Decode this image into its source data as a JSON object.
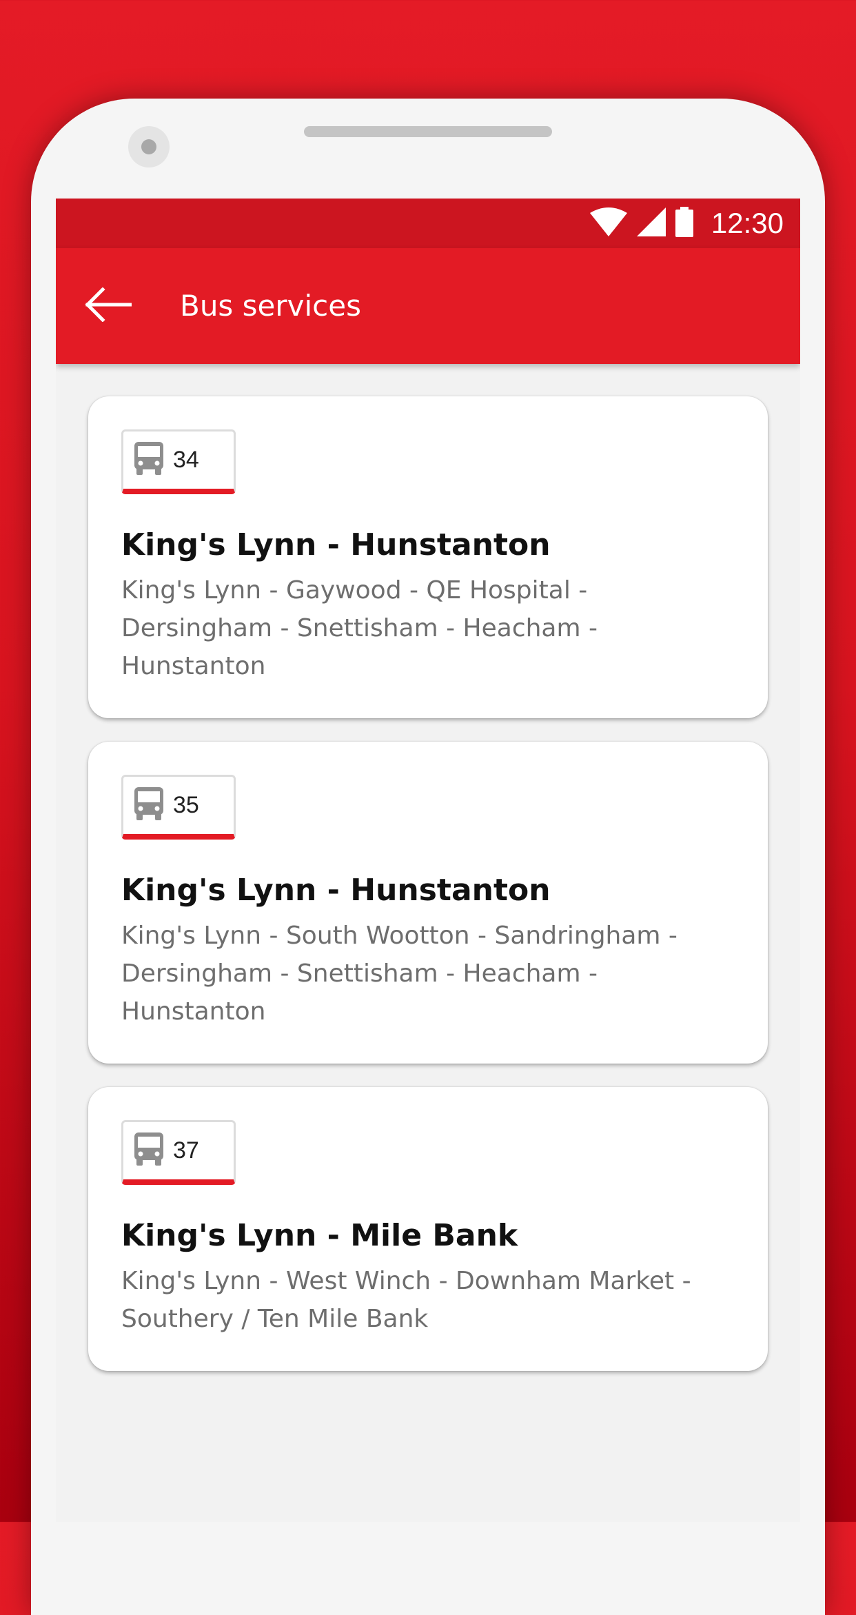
{
  "status_bar": {
    "time": "12:30",
    "icons": [
      "wifi-icon",
      "cell-signal-icon",
      "battery-icon"
    ]
  },
  "app_bar": {
    "title": "Bus services",
    "back_icon": "arrow-back-icon"
  },
  "colors": {
    "primary": "#e31b25",
    "status_bar": "#cc1520",
    "background": "#f2f2f2",
    "card": "#ffffff",
    "title_text": "#111111",
    "secondary_text": "#6e6e6e"
  },
  "services": [
    {
      "number": "34",
      "title": "King's Lynn - Hunstanton",
      "stops": "King's Lynn - Gaywood - QE Hospital - Dersingham - Snettisham - Heacham - Hunstanton"
    },
    {
      "number": "35",
      "title": "King's Lynn - Hunstanton",
      "stops": "King's Lynn - South Wootton - Sandringham - Dersingham - Snettisham - Heacham - Hunstanton"
    },
    {
      "number": "37",
      "title": "King's Lynn - Mile Bank",
      "stops": "King's Lynn - West Winch - Downham Market - Southery / Ten Mile Bank"
    }
  ]
}
